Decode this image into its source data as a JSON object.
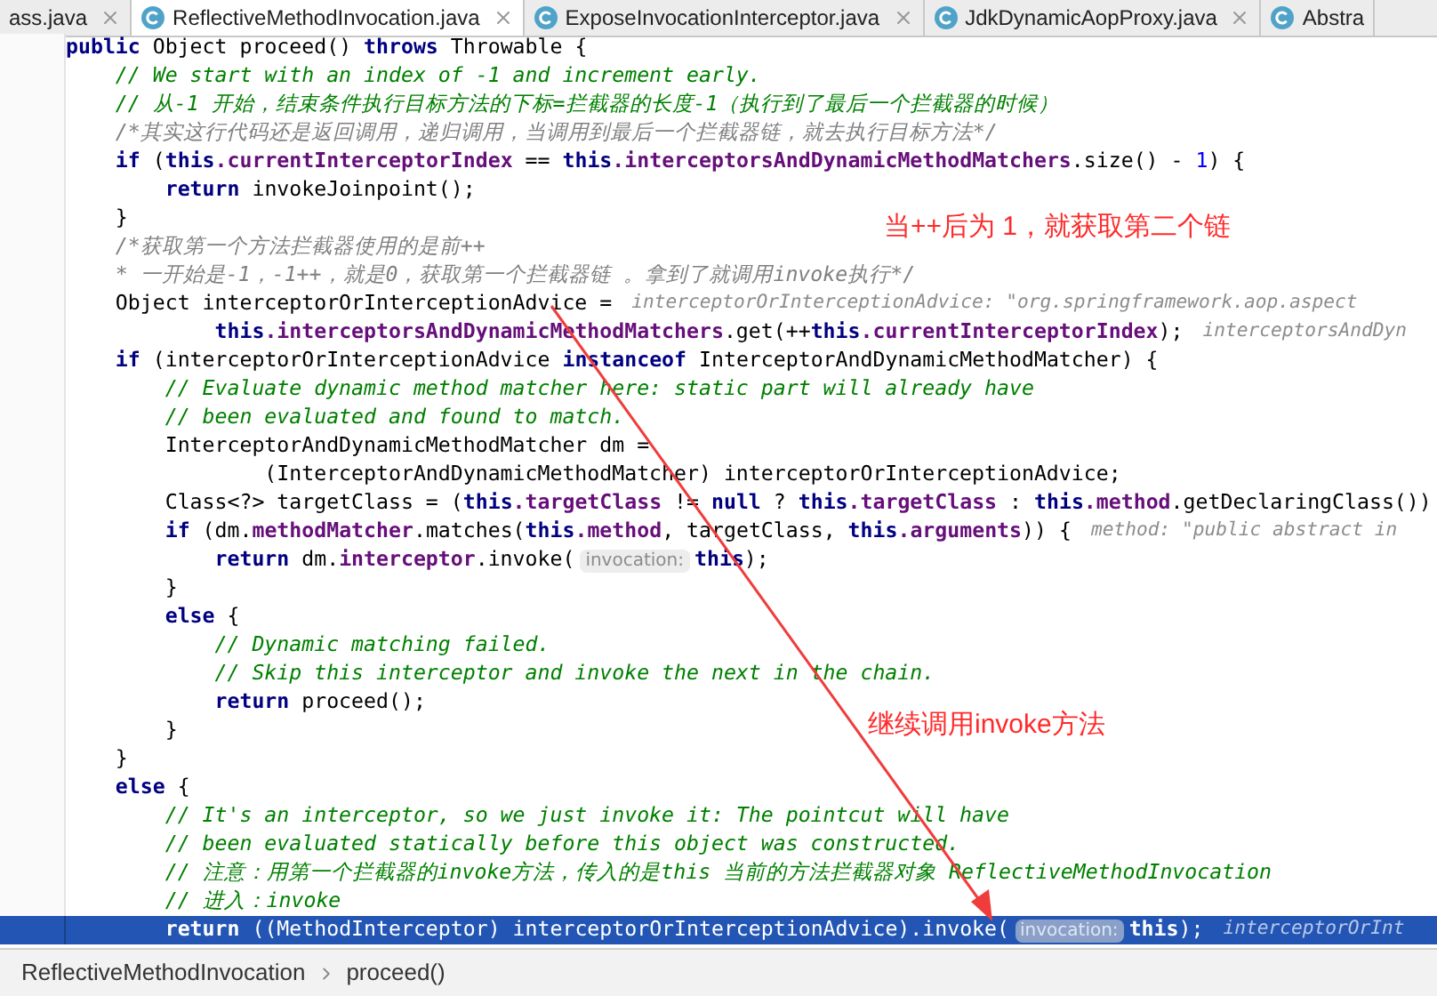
{
  "tabs": [
    {
      "label": "ass.java",
      "selected": false,
      "icon": false,
      "closable": true
    },
    {
      "label": "ReflectiveMethodInvocation.java",
      "selected": true,
      "icon": true,
      "closable": true
    },
    {
      "label": "ExposeInvocationInterceptor.java",
      "selected": false,
      "icon": true,
      "closable": true
    },
    {
      "label": "JdkDynamicAopProxy.java",
      "selected": false,
      "icon": true,
      "closable": true
    },
    {
      "label": "Abstra",
      "selected": false,
      "icon": true,
      "closable": false
    }
  ],
  "lines": [
    {
      "current": false,
      "tokens": [
        {
          "kind": "kw",
          "text": "public"
        },
        {
          "kind": "plain",
          "text": " Object proceed() "
        },
        {
          "kind": "kw",
          "text": "throws"
        },
        {
          "kind": "plain",
          "text": " Throwable {"
        }
      ]
    },
    {
      "current": false,
      "tokens": [
        {
          "kind": "comment",
          "text": "    // We start with an index of -1 and increment early."
        }
      ]
    },
    {
      "current": false,
      "tokens": [
        {
          "kind": "comment",
          "text": "    // 从-1 开始，结束条件执行目标方法的下标=拦截器的长度-1（执行到了最后一个拦截器的时候）"
        }
      ]
    },
    {
      "current": false,
      "tokens": [
        {
          "kind": "doc",
          "text": "    /*其实这行代码还是返回调用，递归调用，当调用到最后一个拦截器链，就去执行目标方法*/"
        }
      ]
    },
    {
      "current": false,
      "tokens": [
        {
          "kind": "kw",
          "text": "    if"
        },
        {
          "kind": "plain",
          "text": " ("
        },
        {
          "kind": "kw",
          "text": "this"
        },
        {
          "kind": "field",
          "text": ".currentInterceptorIndex"
        },
        {
          "kind": "plain",
          "text": " == "
        },
        {
          "kind": "kw",
          "text": "this"
        },
        {
          "kind": "field",
          "text": ".interceptorsAndDynamicMethodMatchers"
        },
        {
          "kind": "plain",
          "text": ".size() - "
        },
        {
          "kind": "num",
          "text": "1"
        },
        {
          "kind": "plain",
          "text": ") {"
        }
      ]
    },
    {
      "current": false,
      "tokens": [
        {
          "kind": "kw",
          "text": "        return"
        },
        {
          "kind": "plain",
          "text": " invokeJoinpoint();"
        }
      ]
    },
    {
      "current": false,
      "tokens": [
        {
          "kind": "plain",
          "text": "    }"
        }
      ]
    },
    {
      "current": false,
      "tokens": [
        {
          "kind": "doc",
          "text": "    /*获取第一个方法拦截器使用的是前++"
        }
      ]
    },
    {
      "current": false,
      "tokens": [
        {
          "kind": "doc",
          "text": "    * 一开始是-1，-1++，就是0，获取第一个拦截器链 。拿到了就调用invoke执行*/"
        }
      ]
    },
    {
      "current": false,
      "tokens": [
        {
          "kind": "plain",
          "text": "    Object interceptorOrInterceptionAdvice = "
        },
        {
          "kind": "hint",
          "text": "interceptorOrInterceptionAdvice: \"org.springframework.aop.aspect"
        }
      ]
    },
    {
      "current": false,
      "tokens": [
        {
          "kind": "kw",
          "text": "            this"
        },
        {
          "kind": "field",
          "text": ".interceptorsAndDynamicMethodMatchers"
        },
        {
          "kind": "plain",
          "text": ".get(++"
        },
        {
          "kind": "kw",
          "text": "this"
        },
        {
          "kind": "field",
          "text": ".currentInterceptorIndex"
        },
        {
          "kind": "plain",
          "text": "); "
        },
        {
          "kind": "hint",
          "text": "interceptorsAndDyn"
        }
      ]
    },
    {
      "current": false,
      "tokens": [
        {
          "kind": "kw",
          "text": "    if"
        },
        {
          "kind": "plain",
          "text": " (interceptorOrInterceptionAdvice "
        },
        {
          "kind": "kw",
          "text": "instanceof"
        },
        {
          "kind": "plain",
          "text": " InterceptorAndDynamicMethodMatcher) {"
        }
      ]
    },
    {
      "current": false,
      "tokens": [
        {
          "kind": "comment",
          "text": "        // Evaluate dynamic method matcher here: static part will already have"
        }
      ]
    },
    {
      "current": false,
      "tokens": [
        {
          "kind": "comment",
          "text": "        // been evaluated and found to match."
        }
      ]
    },
    {
      "current": false,
      "tokens": [
        {
          "kind": "plain",
          "text": "        InterceptorAndDynamicMethodMatcher dm ="
        }
      ]
    },
    {
      "current": false,
      "tokens": [
        {
          "kind": "plain",
          "text": "                (InterceptorAndDynamicMethodMatcher) interceptorOrInterceptionAdvice;"
        }
      ]
    },
    {
      "current": false,
      "tokens": [
        {
          "kind": "plain",
          "text": "        Class<?> targetClass = ("
        },
        {
          "kind": "kw",
          "text": "this"
        },
        {
          "kind": "field",
          "text": ".targetClass"
        },
        {
          "kind": "plain",
          "text": " != "
        },
        {
          "kind": "kw",
          "text": "null"
        },
        {
          "kind": "plain",
          "text": " ? "
        },
        {
          "kind": "kw",
          "text": "this"
        },
        {
          "kind": "field",
          "text": ".targetClass"
        },
        {
          "kind": "plain",
          "text": " : "
        },
        {
          "kind": "kw",
          "text": "this"
        },
        {
          "kind": "field",
          "text": ".method"
        },
        {
          "kind": "plain",
          "text": ".getDeclaringClass())"
        }
      ]
    },
    {
      "current": false,
      "tokens": [
        {
          "kind": "kw",
          "text": "        if"
        },
        {
          "kind": "plain",
          "text": " (dm."
        },
        {
          "kind": "field",
          "text": "methodMatcher"
        },
        {
          "kind": "plain",
          "text": ".matches("
        },
        {
          "kind": "kw",
          "text": "this"
        },
        {
          "kind": "field",
          "text": ".method"
        },
        {
          "kind": "plain",
          "text": ", targetClass, "
        },
        {
          "kind": "kw",
          "text": "this"
        },
        {
          "kind": "field",
          "text": ".arguments"
        },
        {
          "kind": "plain",
          "text": ")) { "
        },
        {
          "kind": "hint",
          "text": "method: \"public abstract in"
        }
      ]
    },
    {
      "current": false,
      "tokens": [
        {
          "kind": "kw",
          "text": "            return"
        },
        {
          "kind": "plain",
          "text": " dm."
        },
        {
          "kind": "field",
          "text": "interceptor"
        },
        {
          "kind": "plain",
          "text": ".invoke("
        },
        {
          "kind": "param",
          "text": "invocation:"
        },
        {
          "kind": "kw",
          "text": "this"
        },
        {
          "kind": "plain",
          "text": ");"
        }
      ]
    },
    {
      "current": false,
      "tokens": [
        {
          "kind": "plain",
          "text": "        }"
        }
      ]
    },
    {
      "current": false,
      "tokens": [
        {
          "kind": "kw",
          "text": "        else"
        },
        {
          "kind": "plain",
          "text": " {"
        }
      ]
    },
    {
      "current": false,
      "tokens": [
        {
          "kind": "comment",
          "text": "            // Dynamic matching failed."
        }
      ]
    },
    {
      "current": false,
      "tokens": [
        {
          "kind": "comment",
          "text": "            // Skip this interceptor and invoke the next in the chain."
        }
      ]
    },
    {
      "current": false,
      "tokens": [
        {
          "kind": "kw",
          "text": "            return"
        },
        {
          "kind": "plain",
          "text": " proceed();"
        }
      ]
    },
    {
      "current": false,
      "tokens": [
        {
          "kind": "plain",
          "text": "        }"
        }
      ]
    },
    {
      "current": false,
      "tokens": [
        {
          "kind": "plain",
          "text": "    }"
        }
      ]
    },
    {
      "current": false,
      "tokens": [
        {
          "kind": "kw",
          "text": "    else"
        },
        {
          "kind": "plain",
          "text": " {"
        }
      ]
    },
    {
      "current": false,
      "tokens": [
        {
          "kind": "comment",
          "text": "        // It's an interceptor, so we just invoke it: The pointcut will have"
        }
      ]
    },
    {
      "current": false,
      "tokens": [
        {
          "kind": "comment",
          "text": "        // been evaluated statically before this object was constructed."
        }
      ]
    },
    {
      "current": false,
      "tokens": [
        {
          "kind": "comment",
          "text": "        // 注意：用第一个拦截器的invoke方法，传入的是this 当前的方法拦截器对象 ReflectiveMethodInvocation"
        }
      ]
    },
    {
      "current": false,
      "tokens": [
        {
          "kind": "comment",
          "text": "        // 进入：invoke"
        }
      ]
    },
    {
      "current": true,
      "tokens": [
        {
          "kind": "kw",
          "text": "        return"
        },
        {
          "kind": "plain",
          "text": " ((MethodInterceptor) interceptorOrInterceptionAdvice).invoke("
        },
        {
          "kind": "param",
          "text": "invocation:"
        },
        {
          "kind": "kw",
          "text": "this"
        },
        {
          "kind": "plain",
          "text": "); "
        },
        {
          "kind": "hint",
          "text": "interceptorOrInt"
        }
      ]
    }
  ],
  "annotations": [
    {
      "text": "当++后为 1，就获取第二个链"
    },
    {
      "text": "继续调用invoke方法"
    }
  ],
  "breadcrumbs": [
    "ReflectiveMethodInvocation",
    "proceed()"
  ]
}
